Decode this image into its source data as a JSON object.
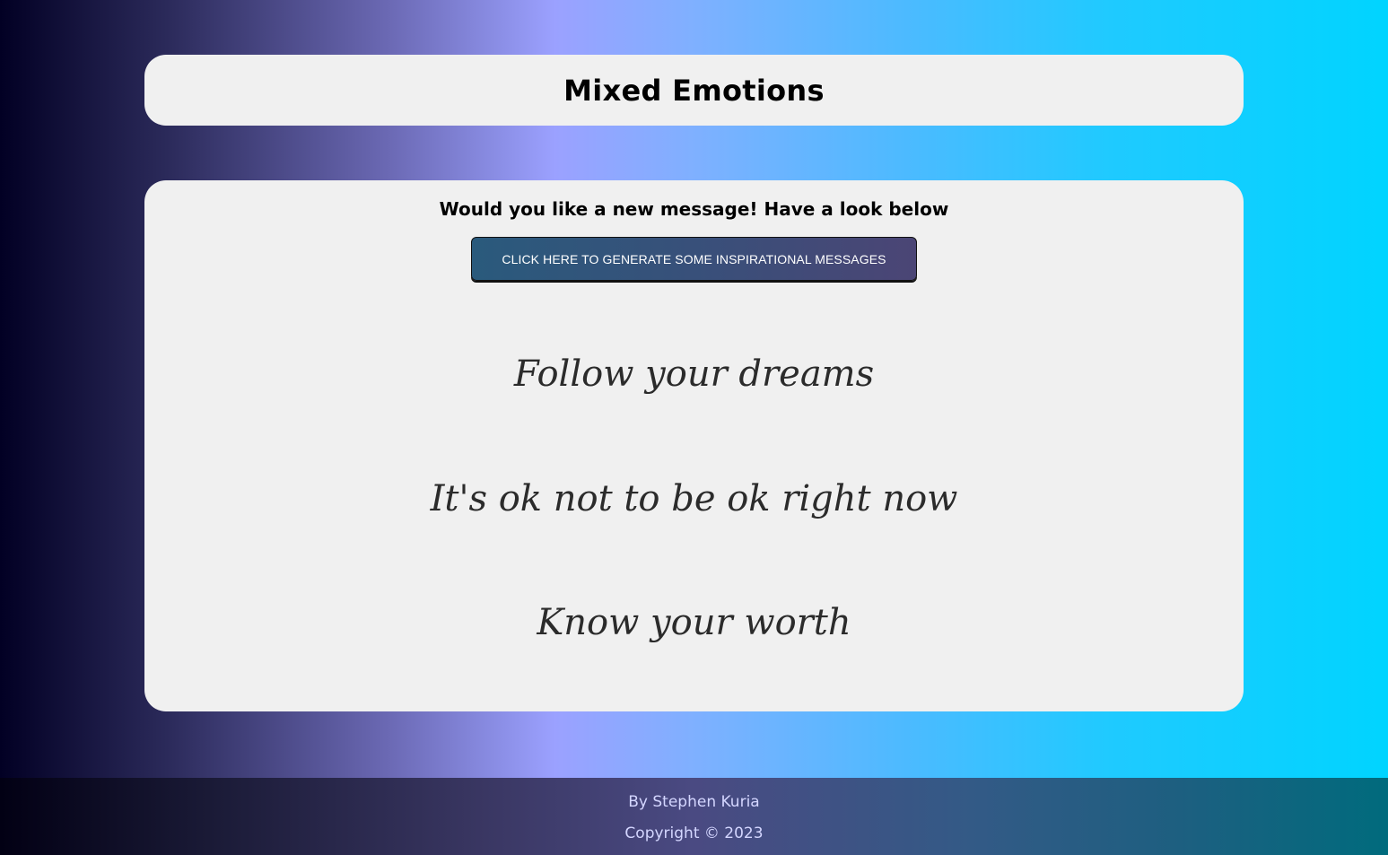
{
  "header": {
    "title": "Mixed Emotions"
  },
  "main": {
    "prompt": "Would you like a new message! Have a look below",
    "generate_button_label": "CLICK HERE TO GENERATE SOME INSPIRATIONAL MESSAGES",
    "messages": [
      "Follow your dreams",
      "It's ok not to be ok right now",
      "Know your worth"
    ]
  },
  "footer": {
    "author": "By Stephen Kuria",
    "copyright": "Copyright © 2023"
  },
  "colors": {
    "card_background": "#f0f0f0",
    "gradient_start": "#020024",
    "gradient_mid": "#9ba1ff",
    "gradient_end": "#00d4ff"
  }
}
